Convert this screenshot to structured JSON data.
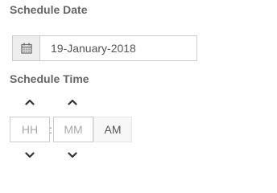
{
  "schedule_date": {
    "label": "Schedule Date",
    "value": "19-January-2018",
    "icon": "calendar-icon"
  },
  "schedule_time": {
    "label": "Schedule Time",
    "hours_placeholder": "HH",
    "minutes_placeholder": "MM",
    "separator": ":",
    "period": "AM",
    "up_icon": "chevron-up-icon",
    "down_icon": "chevron-down-icon"
  }
}
